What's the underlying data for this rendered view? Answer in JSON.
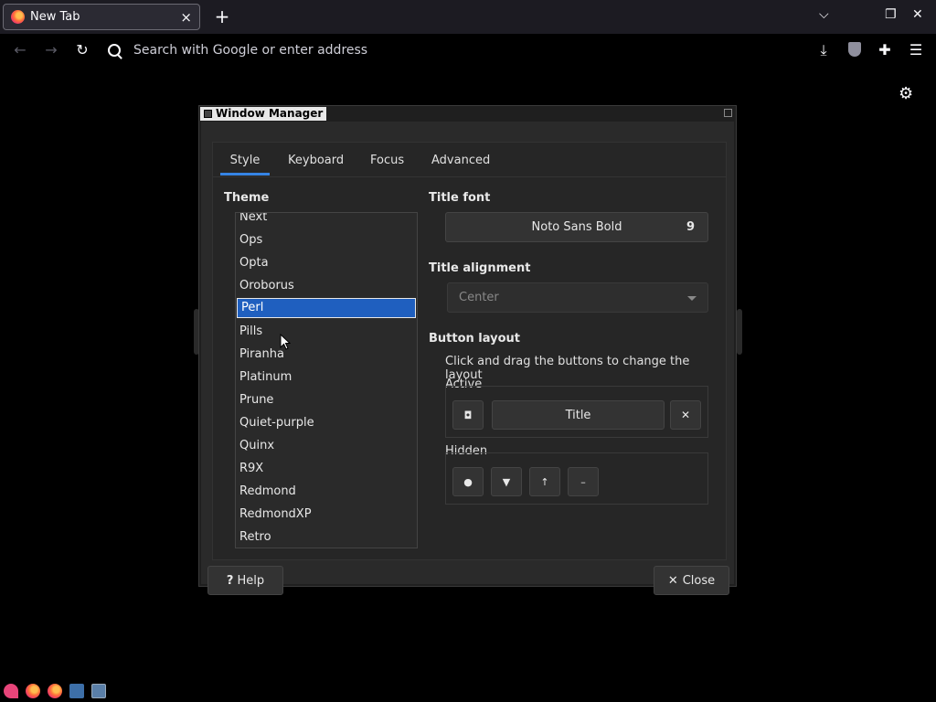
{
  "browser": {
    "tab_title": "New Tab",
    "close_tab": "×",
    "new_tab": "+",
    "url_placeholder": "Search with Google or enter address"
  },
  "dialog": {
    "title": "Window Manager",
    "tabs": [
      {
        "label": "Style",
        "active": true
      },
      {
        "label": "Keyboard"
      },
      {
        "label": "Focus"
      },
      {
        "label": "Advanced"
      }
    ],
    "theme": {
      "label": "Theme",
      "items": [
        "Next",
        "Ops",
        "Opta",
        "Oroborus",
        "Perl",
        "Pills",
        "Piranha",
        "Platinum",
        "Prune",
        "Quiet-purple",
        "Quinx",
        "R9X",
        "Redmond",
        "RedmondXP",
        "Retro"
      ],
      "selected": "Perl"
    },
    "title_font": {
      "label": "Title font",
      "font_name": "Noto Sans Bold",
      "font_size": "9"
    },
    "title_alignment": {
      "label": "Title alignment",
      "value": "Center"
    },
    "button_layout": {
      "label": "Button layout",
      "hint": "Click and drag the buttons to change the layout",
      "active_label": "Active",
      "title_button": "Title",
      "close_glyph": "✕",
      "menu_glyph": "◘",
      "hidden_label": "Hidden",
      "hidden_buttons": [
        "●",
        "▼",
        "↑",
        "–"
      ]
    },
    "help_label": "Help",
    "help_glyph": "?",
    "close_label": "Close",
    "close_glyph": "✕"
  },
  "colors": {
    "accent": "#3584e4",
    "selection": "#1f5fbf"
  }
}
